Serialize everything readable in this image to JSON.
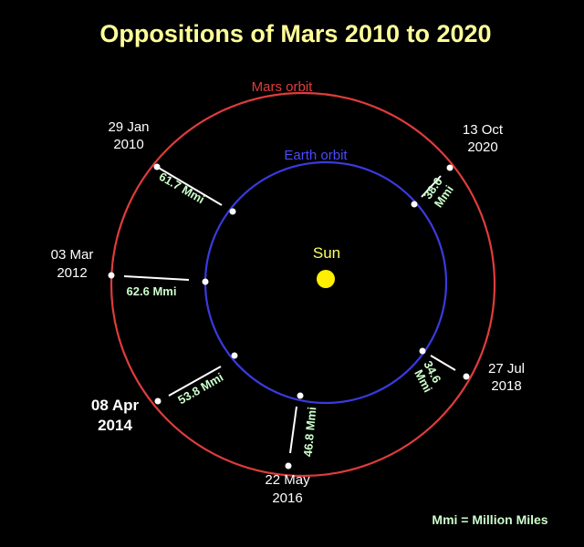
{
  "title": "Oppositions of Mars 2010 to 2020",
  "colors": {
    "background": "#000000",
    "title": "#ffff99",
    "mars_orbit": "#e03c3c",
    "earth_orbit": "#3a3ae0",
    "sun": "#ffee00",
    "sun_label": "#ffff66",
    "distance_label": "#ccffcc",
    "date_label": "#ffffff",
    "connector": "#ffffff"
  },
  "labels": {
    "mars_orbit": "Mars orbit",
    "earth_orbit": "Earth orbit",
    "sun": "Sun",
    "legend": "Mmi = Million Miles"
  },
  "oppositions": [
    {
      "date_line1": "29 Jan",
      "date_line2": "2010",
      "distance": "61.7 Mmi"
    },
    {
      "date_line1": "03 Mar",
      "date_line2": "2012",
      "distance": "62.6 Mmi"
    },
    {
      "date_line1": "08 Apr",
      "date_line2": "2014",
      "distance": "53.8 Mmi"
    },
    {
      "date_line1": "22 May",
      "date_line2": "2016",
      "distance": "46.8 Mmi"
    },
    {
      "date_line1": "27 Jul",
      "date_line2": "2018",
      "distance_line1": "34.6",
      "distance_line2": "Mmi"
    },
    {
      "date_line1": "13 Oct",
      "date_line2": "2020",
      "distance_line1": "38.6",
      "distance_line2": "Mmi"
    }
  ]
}
